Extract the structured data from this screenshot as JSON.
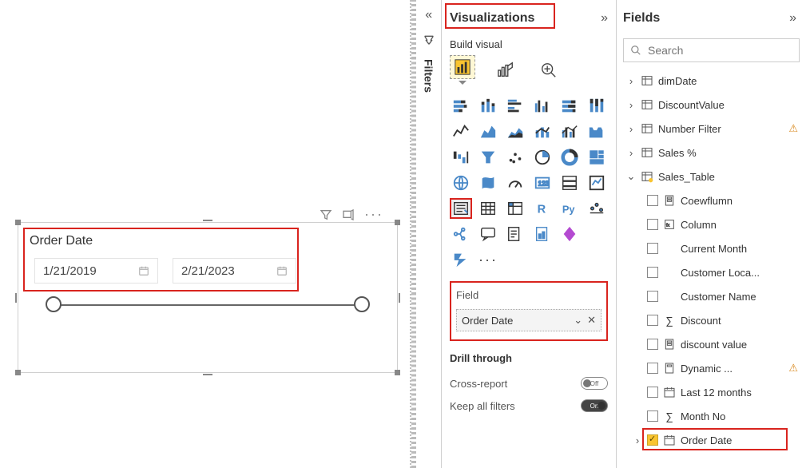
{
  "canvas": {
    "slicer": {
      "title": "Order Date",
      "start": "1/21/2019",
      "end": "2/21/2023"
    }
  },
  "filters": {
    "label": "Filters"
  },
  "viz": {
    "title": "Visualizations",
    "build_label": "Build visual",
    "field_section_label": "Field",
    "field_pill": "Order Date",
    "drill": {
      "heading": "Drill through",
      "cross_label": "Cross-report",
      "cross_state": "Off",
      "keep_label": "Keep all filters",
      "keep_state": "On"
    }
  },
  "fields": {
    "title": "Fields",
    "search_placeholder": "Search",
    "tables": [
      {
        "name": "dimDate",
        "expanded": false
      },
      {
        "name": "DiscountValue",
        "expanded": false
      },
      {
        "name": "Number Filter",
        "expanded": false,
        "warn": true
      },
      {
        "name": "Sales %",
        "expanded": false
      },
      {
        "name": "Sales_Table",
        "expanded": true,
        "columns": [
          {
            "name": "Coewflumn",
            "icon": "calc"
          },
          {
            "name": "Column",
            "icon": "fx"
          },
          {
            "name": "Current Month",
            "icon": "none"
          },
          {
            "name": "Customer Loca...",
            "icon": "none"
          },
          {
            "name": "Customer Name",
            "icon": "none"
          },
          {
            "name": "Discount",
            "icon": "sigma"
          },
          {
            "name": "discount value",
            "icon": "calc"
          },
          {
            "name": "Dynamic ...",
            "icon": "calc",
            "warn": true
          },
          {
            "name": "Last 12 months",
            "icon": "calendar"
          },
          {
            "name": "Month No",
            "icon": "sigma"
          },
          {
            "name": "Order Date",
            "icon": "calendar",
            "checked": true,
            "highlight": true,
            "caret": true
          }
        ]
      }
    ]
  }
}
